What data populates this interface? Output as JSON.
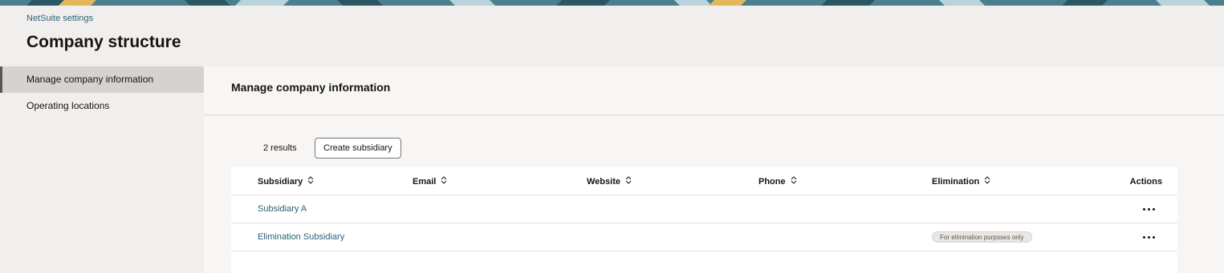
{
  "header": {
    "breadcrumb": "NetSuite settings",
    "title": "Company structure"
  },
  "sidebar": {
    "items": [
      {
        "label": "Manage company information",
        "active": true
      },
      {
        "label": "Operating locations",
        "active": false
      }
    ]
  },
  "main": {
    "section_title": "Manage company information",
    "results_count": "2 results",
    "create_button": "Create subsidiary",
    "table": {
      "columns": [
        "Subsidiary",
        "Email",
        "Website",
        "Phone",
        "Elimination",
        "Actions"
      ],
      "rows": [
        {
          "subsidiary": "Subsidiary A",
          "email": "",
          "website": "",
          "phone": "",
          "elimination": ""
        },
        {
          "subsidiary": "Elimination Subsidiary",
          "email": "",
          "website": "",
          "phone": "",
          "elimination": "For elimination purposes only"
        }
      ]
    }
  },
  "colors": {
    "banner_dark": "#2d5665",
    "banner_teal": "#4a7f8e",
    "banner_light": "#b9d3dc",
    "banner_gold": "#e3b85c",
    "link": "#2a6177"
  },
  "icons": {
    "sort": "sort-updown-icon",
    "actions": "more-horizontal-icon"
  }
}
